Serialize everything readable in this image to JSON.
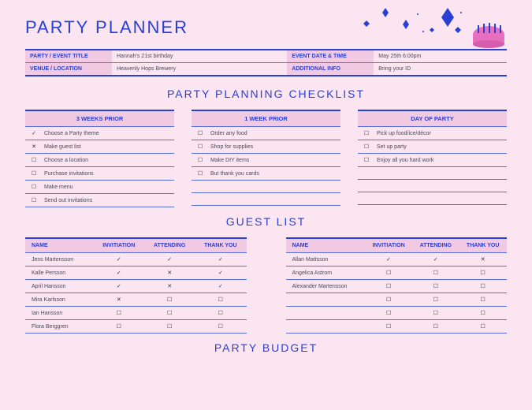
{
  "title": "PARTY PLANNER",
  "info": {
    "labels": {
      "party_title": "PARTY / EVENT TITLE",
      "venue": "VENUE / LOCATION",
      "date": "EVENT DATE & TIME",
      "add": "ADDITIONAL INFO"
    },
    "values": {
      "party_title": "Hannah's 21st birthday",
      "venue": "Heavenly Hops Brewery",
      "date": "May 25th 6:00pm",
      "add": "Bring your ID"
    }
  },
  "sections": {
    "checklist": "PARTY PLANNING CHECKLIST",
    "guests": "GUEST LIST",
    "budget": "PARTY BUDGET"
  },
  "checklist": {
    "cols": [
      {
        "header": "3 WEEKS PRIOR",
        "items": [
          {
            "mark": "✓",
            "text": "Choose a Party theme"
          },
          {
            "mark": "✕",
            "text": "Make guest list"
          },
          {
            "mark": "☐",
            "text": "Choose a location"
          },
          {
            "mark": "☐",
            "text": "Purchase invitations"
          },
          {
            "mark": "☐",
            "text": "Make menu"
          },
          {
            "mark": "☐",
            "text": "Send out invitations"
          }
        ]
      },
      {
        "header": "1 WEEK PRIOR",
        "items": [
          {
            "mark": "☐",
            "text": "Order any food"
          },
          {
            "mark": "☐",
            "text": "Shop for supplies"
          },
          {
            "mark": "☐",
            "text": "Make DIY items"
          },
          {
            "mark": "☐",
            "text": "But thank you cards"
          },
          {
            "mark": "",
            "text": ""
          },
          {
            "mark": "",
            "text": ""
          }
        ]
      },
      {
        "header": "DAY OF PARTY",
        "items": [
          {
            "mark": "☐",
            "text": "Pick up food/ice/décor"
          },
          {
            "mark": "☐",
            "text": "Set up party"
          },
          {
            "mark": "☐",
            "text": "Enjoy all you hard work"
          },
          {
            "mark": "",
            "text": ""
          },
          {
            "mark": "",
            "text": ""
          },
          {
            "mark": "",
            "text": ""
          }
        ]
      }
    ]
  },
  "guest_headers": {
    "name": "NAME",
    "inv": "INVITIATION",
    "att": "ATTENDING",
    "ty": "THANK YOU"
  },
  "guests_left": [
    {
      "name": "Jens Martensson",
      "inv": "✓",
      "att": "✓",
      "ty": "✓"
    },
    {
      "name": "Kalle Persson",
      "inv": "✓",
      "att": "✕",
      "ty": "✓"
    },
    {
      "name": "April Hansson",
      "inv": "✓",
      "att": "✕",
      "ty": "✓"
    },
    {
      "name": "Mira Karlsson",
      "inv": "✕",
      "att": "☐",
      "ty": "☐"
    },
    {
      "name": "Ian Hansson",
      "inv": "☐",
      "att": "☐",
      "ty": "☐"
    },
    {
      "name": "Flora Berggren",
      "inv": "☐",
      "att": "☐",
      "ty": "☐"
    }
  ],
  "guests_right": [
    {
      "name": "Allan Mattsson",
      "inv": "✓",
      "att": "✓",
      "ty": "✕"
    },
    {
      "name": "Angelica Astrom",
      "inv": "☐",
      "att": "☐",
      "ty": "☐"
    },
    {
      "name": "Alexander Martensson",
      "inv": "☐",
      "att": "☐",
      "ty": "☐"
    },
    {
      "name": "",
      "inv": "☐",
      "att": "☐",
      "ty": "☐"
    },
    {
      "name": "",
      "inv": "☐",
      "att": "☐",
      "ty": "☐"
    },
    {
      "name": "",
      "inv": "☐",
      "att": "☐",
      "ty": "☐"
    }
  ]
}
